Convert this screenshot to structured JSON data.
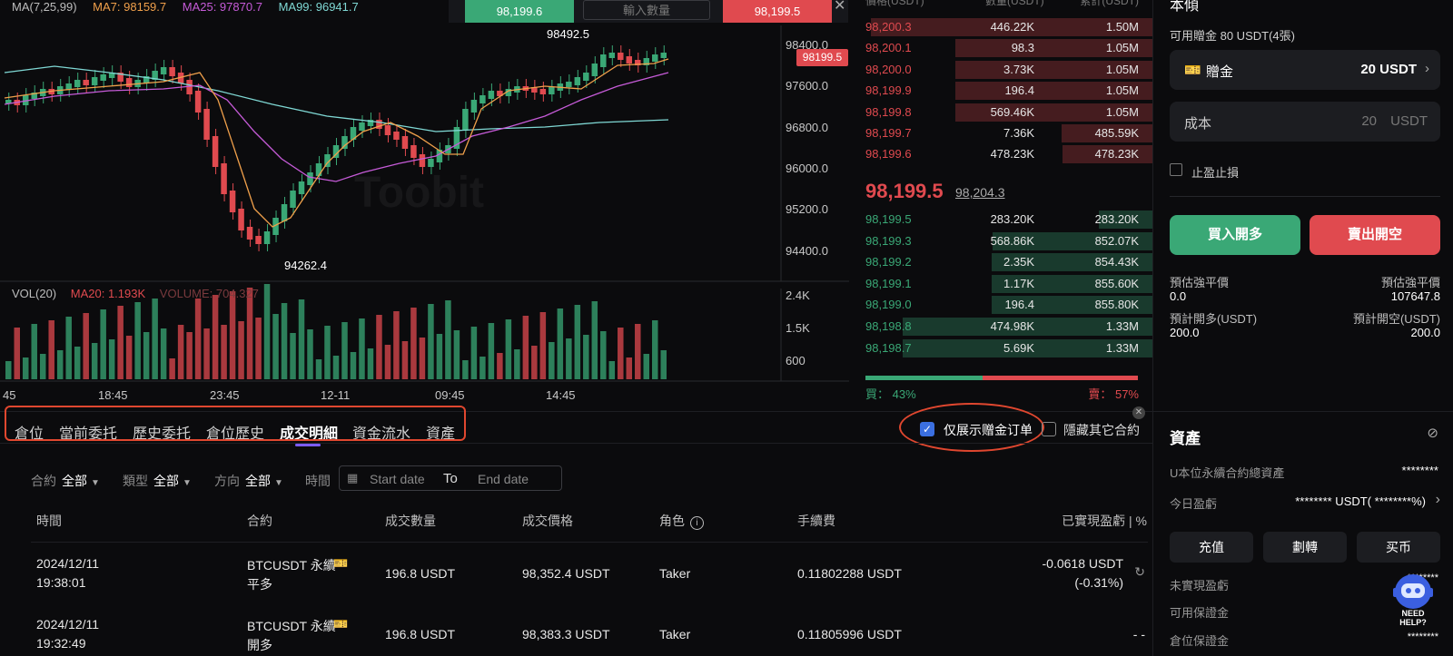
{
  "indicators": {
    "ma_label": "MA(7,25,99)",
    "ma7": "MA7: 98159.7",
    "ma25": "MA25: 97870.7",
    "ma99": "MA99: 96941.7",
    "vol_label": "VOL(20)",
    "ma20": "MA20: 1.193K",
    "volume": "VOLUME: 704.327",
    "watermark": "Toobit"
  },
  "chart": {
    "price_ticks": [
      "98400.0",
      "97600.0",
      "96800.0",
      "96000.0",
      "95200.0",
      "94400.0"
    ],
    "vol_ticks": [
      "2.4K",
      "1.5K",
      "600"
    ],
    "time_ticks": [
      "45",
      "18:45",
      "23:45",
      "12-11",
      "09:45",
      "14:45"
    ],
    "high_label": "98492.5",
    "low_label": "94262.4",
    "last_price_tag": "98199.5",
    "colors": {
      "up": "#3aa876",
      "down": "#e04a4f",
      "ma7": "#f0a04b",
      "ma25": "#c65bd8",
      "ma99": "#7fd8d4"
    }
  },
  "mini_trade": {
    "buy_price": "98,199.6",
    "qty_placeholder": "輸入數量",
    "sell_price": "98,199.5"
  },
  "orderbook": {
    "header": {
      "price": "價格(USDT)",
      "qty": "數量(USDT)",
      "total": "累計(USDT)"
    },
    "asks": [
      {
        "price": "98,200.3",
        "qty": "446.22K",
        "total": "1.50M"
      },
      {
        "price": "98,200.1",
        "qty": "98.3",
        "total": "1.05M"
      },
      {
        "price": "98,200.0",
        "qty": "3.73K",
        "total": "1.05M"
      },
      {
        "price": "98,199.9",
        "qty": "196.4",
        "total": "1.05M"
      },
      {
        "price": "98,199.8",
        "qty": "569.46K",
        "total": "1.05M"
      },
      {
        "price": "98,199.7",
        "qty": "7.36K",
        "total": "485.59K"
      },
      {
        "price": "98,199.6",
        "qty": "478.23K",
        "total": "478.23K"
      }
    ],
    "last_price": "98,199.5",
    "mark_price": "98,204.3",
    "bids": [
      {
        "price": "98,199.5",
        "qty": "283.20K",
        "total": "283.20K"
      },
      {
        "price": "98,199.3",
        "qty": "568.86K",
        "total": "852.07K"
      },
      {
        "price": "98,199.2",
        "qty": "2.35K",
        "total": "854.43K"
      },
      {
        "price": "98,199.1",
        "qty": "1.17K",
        "total": "855.60K"
      },
      {
        "price": "98,199.0",
        "qty": "196.4",
        "total": "855.80K"
      },
      {
        "price": "98,198.8",
        "qty": "474.98K",
        "total": "1.33M"
      },
      {
        "price": "98,198.7",
        "qty": "5.69K",
        "total": "1.33M"
      }
    ],
    "ratio_buy": "買： 43%",
    "ratio_sell": "賣： 57%",
    "buy_fraction": 0.43
  },
  "trade_panel": {
    "title": "本傾",
    "bonus_available": "可用贈金 80 USDT(4張)",
    "bonus_label": "贈金",
    "bonus_value": "20 USDT",
    "cost_label": "成本",
    "cost_value": "20",
    "cost_unit": "USDT",
    "tpsl_label": "止盈止損",
    "buy_btn": "買入開多",
    "sell_btn": "賣出開空",
    "liq_long_label": "預估強平價",
    "liq_long_value": "0.0",
    "liq_short_label": "預估強平價",
    "liq_short_value": "107647.8",
    "cost_long_label": "預計開多(USDT)",
    "cost_long_value": "200.0",
    "cost_short_label": "預計開空(USDT)",
    "cost_short_value": "200.0"
  },
  "tabs": [
    "倉位",
    "當前委托",
    "歷史委托",
    "倉位歷史",
    "成交明細",
    "資金流水",
    "資產"
  ],
  "options": {
    "only_bonus": "仅展示赠金订单",
    "hide_other": "隱藏其它合約"
  },
  "filters": {
    "contract_label": "合約",
    "contract_value": "全部",
    "type_label": "類型",
    "type_value": "全部",
    "direction_label": "方向",
    "direction_value": "全部",
    "time_label": "時間",
    "start_placeholder": "Start date",
    "to": "To",
    "end_placeholder": "End date"
  },
  "table": {
    "headers": [
      "時間",
      "合約",
      "成交數量",
      "成交價格",
      "角色",
      "手續費",
      "已實現盈虧 | %"
    ],
    "rows": [
      {
        "date": "2024/12/11",
        "time": "19:38:01",
        "contract": "BTCUSDT 永續",
        "side": "平多",
        "qty": "196.8 USDT",
        "price": "98,352.4 USDT",
        "role": "Taker",
        "fee": "0.11802288 USDT",
        "pnl": "-0.0618 USDT",
        "pnl_pct": "(-0.31%)"
      },
      {
        "date": "2024/12/11",
        "time": "19:32:49",
        "contract": "BTCUSDT 永續",
        "side": "開多",
        "qty": "196.8 USDT",
        "price": "98,383.3 USDT",
        "role": "Taker",
        "fee": "0.11805996 USDT",
        "pnl": "- -",
        "pnl_pct": ""
      }
    ]
  },
  "assets": {
    "title": "資產",
    "total_label": "U本位永續合約總資產",
    "total_value": "********",
    "today_label": "今日盈虧",
    "today_value": "******** USDT( ********%)",
    "deposit": "充值",
    "transfer": "劃轉",
    "buy_coin": "买币",
    "unrealized_label": "未實現盈虧",
    "unrealized_value": "********",
    "margin_label": "可用保證金",
    "pos_margin_label": "倉位保證金",
    "pos_margin_value": "********",
    "help": "NEED HELP?"
  }
}
